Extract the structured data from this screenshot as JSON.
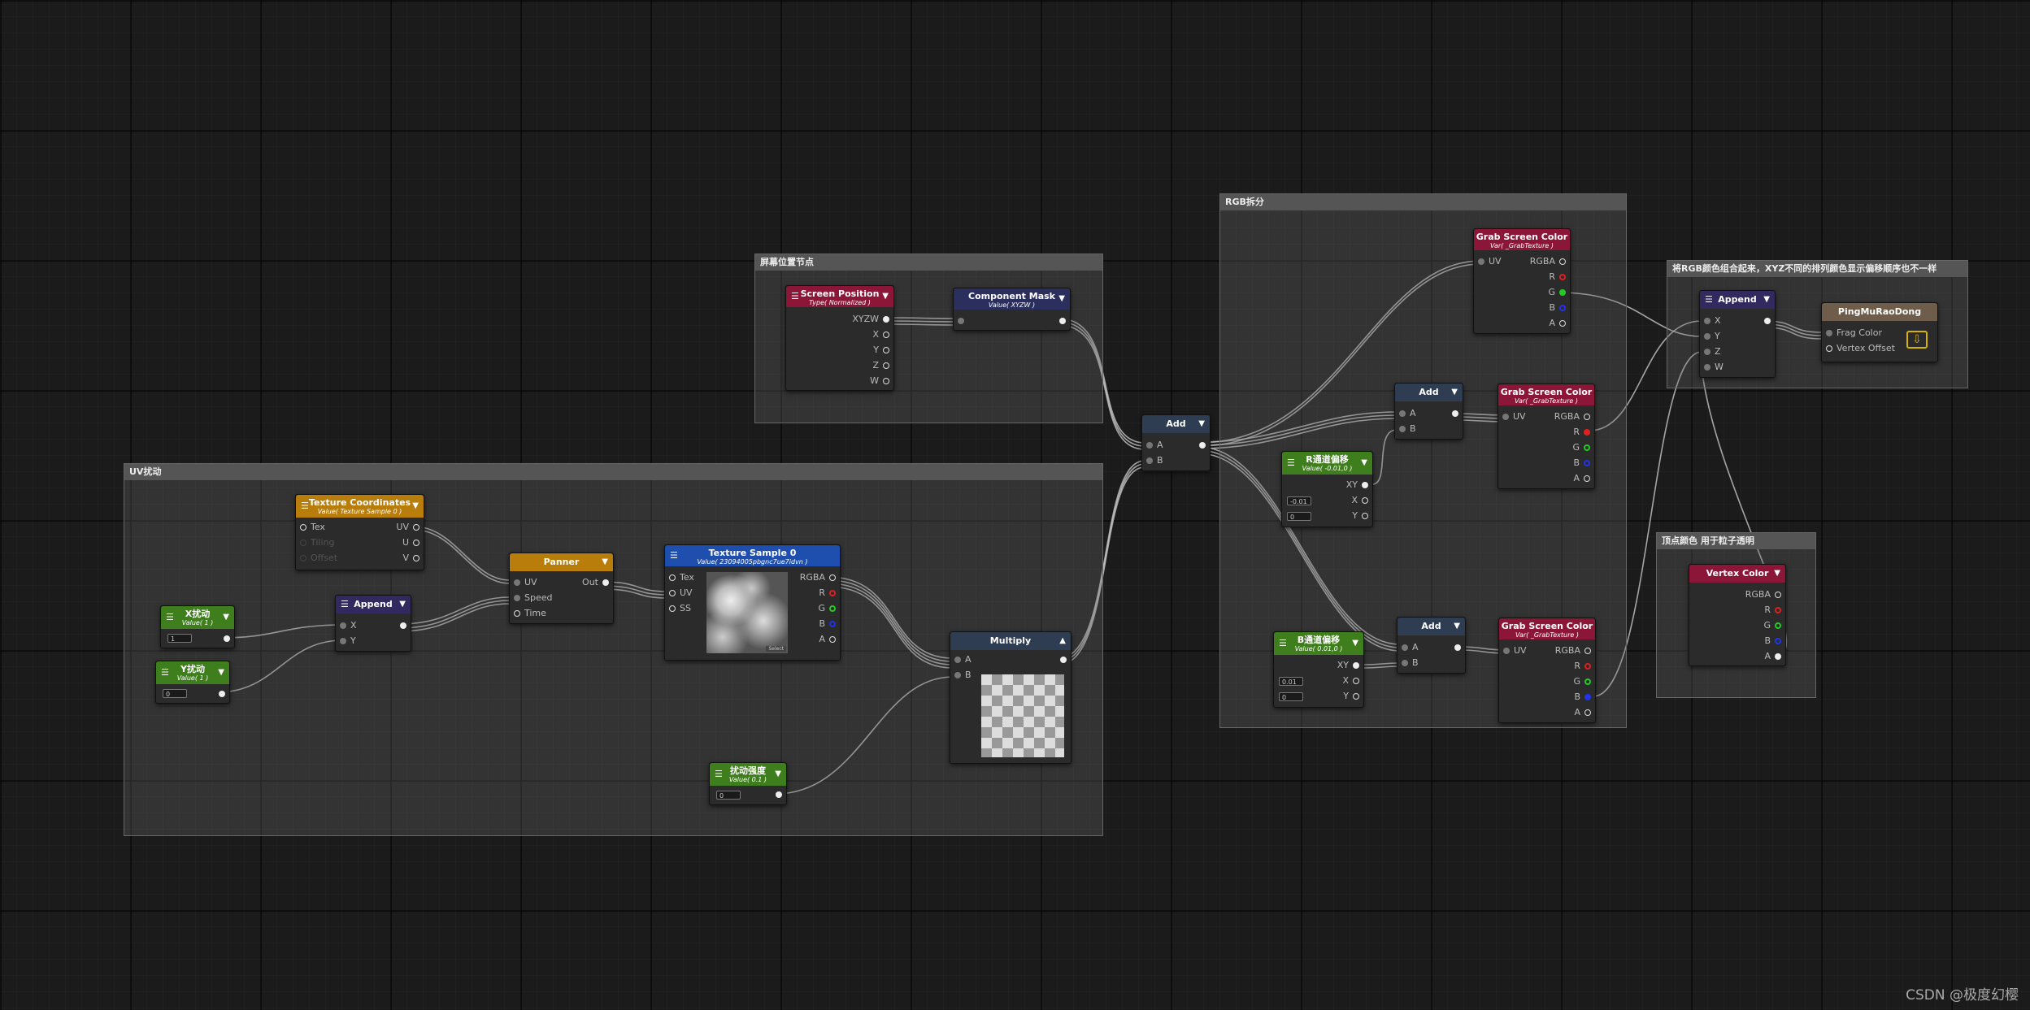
{
  "groups": {
    "uv": "UV扰动",
    "screen": "屏幕位置节点",
    "rgb": "RGB拆分",
    "append": "将RGB颜色组合起来，XYZ不同的排列颜色显示偏移顺序也不一样",
    "vertex": "顶点颜色 用于粒子透明"
  },
  "nodes": {
    "texcoord": {
      "title": "Texture Coordinates",
      "sub": "Value( Texture Sample 0 )",
      "tex": "Tex",
      "tiling": "Tiling",
      "offset": "Offset",
      "uv": "UV",
      "u": "U",
      "v": "V",
      "color": "#b87d0a"
    },
    "xrao": {
      "title": "X扰动",
      "sub": "Value( 1 )",
      "value": "1",
      "color": "#3f7e1d"
    },
    "yrao": {
      "title": "Y扰动",
      "sub": "Value( 1 )",
      "value": "0",
      "color": "#3f7e1d"
    },
    "append1": {
      "title": "Append",
      "x": "X",
      "y": "Y",
      "color": "#322a5e"
    },
    "panner": {
      "title": "Panner",
      "uv": "UV",
      "speed": "Speed",
      "time": "Time",
      "out": "Out",
      "color": "#b87d0a"
    },
    "texsample": {
      "title": "Texture Sample 0",
      "sub": "Value( 23094005pbgnc7ue7idvn )",
      "tex": "Tex",
      "uv": "UV",
      "ss": "SS",
      "rgba": "RGBA",
      "r": "R",
      "g": "G",
      "b": "B",
      "a": "A",
      "select": "Select",
      "color": "#1f4fae"
    },
    "multiply": {
      "title": "Multiply",
      "a": "A",
      "b": "B",
      "color": "#2e3d52"
    },
    "strength": {
      "title": "扰动强度",
      "sub": "Value( 0.1 )",
      "value": "0",
      "color": "#3f7e1d"
    },
    "screenpos": {
      "title": "Screen Position",
      "sub": "Type( Normalized )",
      "xyzw": "XYZW",
      "x": "X",
      "y": "Y",
      "z": "Z",
      "w": "W",
      "color": "#8c1638"
    },
    "compmask": {
      "title": "Component Mask",
      "sub": "Value( XYZW )",
      "color": "#2a2f5e"
    },
    "add1": {
      "title": "Add",
      "a": "A",
      "b": "B",
      "color": "#2e3d52"
    },
    "grab1": {
      "title": "Grab Screen Color",
      "sub": "Var( _GrabTexture )",
      "uv": "UV",
      "rgba": "RGBA",
      "r": "R",
      "g": "G",
      "b": "B",
      "a": "A",
      "color": "#8c1638"
    },
    "add2": {
      "title": "Add",
      "a": "A",
      "b": "B",
      "color": "#2e3d52"
    },
    "rshift": {
      "title": "R通道偏移",
      "sub": "Value( -0.01,0 )",
      "xy": "XY",
      "x": "X",
      "y": "Y",
      "vx": "-0.01",
      "vy": "0",
      "color": "#3f7e1d"
    },
    "grab2": {
      "title": "Grab Screen Color",
      "sub": "Var( _GrabTexture )",
      "uv": "UV",
      "rgba": "RGBA",
      "r": "R",
      "g": "G",
      "b": "B",
      "a": "A",
      "color": "#8c1638"
    },
    "bshift": {
      "title": "B通道偏移",
      "sub": "Value( 0.01,0 )",
      "xy": "XY",
      "x": "X",
      "y": "Y",
      "vx": "0.01",
      "vy": "0",
      "color": "#3f7e1d"
    },
    "add3": {
      "title": "Add",
      "a": "A",
      "b": "B",
      "color": "#2e3d52"
    },
    "grab3": {
      "title": "Grab Screen Color",
      "sub": "Var( _GrabTexture )",
      "uv": "UV",
      "rgba": "RGBA",
      "r": "R",
      "g": "G",
      "b": "B",
      "a": "A",
      "color": "#8c1638"
    },
    "append2": {
      "title": "Append",
      "x": "X",
      "y": "Y",
      "z": "Z",
      "w": "W",
      "color": "#322a5e"
    },
    "output": {
      "title": "PingMuRaoDong",
      "frag": "Frag Color",
      "vertex": "Vertex Offset",
      "color": "#6e5d4a"
    },
    "vertexcolor": {
      "title": "Vertex Color",
      "rgba": "RGBA",
      "r": "R",
      "g": "G",
      "b": "B",
      "a": "A",
      "color": "#8c1638"
    }
  },
  "icons": {
    "menu": "hamburger-icon",
    "dropdown": "dropdown-arrow-icon",
    "output": "output-download-icon"
  },
  "watermark": "CSDN @极度幻樱"
}
